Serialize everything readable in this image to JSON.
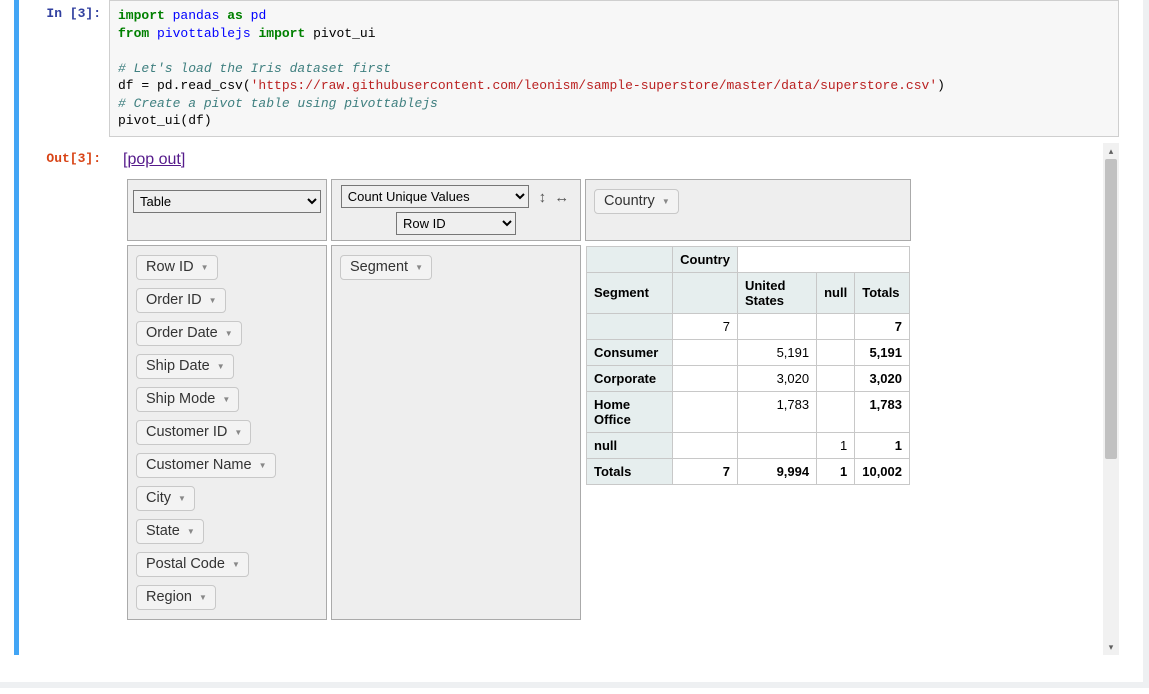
{
  "prompt": {
    "in": "In [3]:",
    "out": "Out[3]:"
  },
  "code": {
    "l1_kw1": "import",
    "l1_mod": "pandas",
    "l1_kw2": "as",
    "l1_alias": "pd",
    "l2_kw1": "from",
    "l2_mod": "pivottablejs",
    "l2_kw2": "import",
    "l2_name": "pivot_ui",
    "l4_comment": "# Let's load the Iris dataset first",
    "l5_a": "df = pd.read_csv(",
    "l5_str": "'https://raw.githubusercontent.com/leonism/sample-superstore/master/data/superstore.csv'",
    "l5_b": ")",
    "l6_comment": "# Create a pivot table using pivottablejs",
    "l7": "pivot_ui(df)"
  },
  "popout": "[pop out]",
  "renderer": "Table",
  "aggregator": "Count Unique Values",
  "aggregator_attr": "Row ID",
  "sort_row_icon": "↕",
  "sort_col_icon": "↔",
  "col_field": "Country",
  "row_field": "Segment",
  "unused_fields": [
    "Row ID",
    "Order ID",
    "Order Date",
    "Ship Date",
    "Ship Mode",
    "Customer ID",
    "Customer Name",
    "City",
    "State",
    "Postal Code",
    "Region"
  ],
  "table": {
    "col_axis": "Country",
    "row_axis": "Segment",
    "col_headers": [
      "United States",
      "null",
      "Totals"
    ],
    "rows": [
      {
        "label": "",
        "empty": "7",
        "cells": [
          "",
          "",
          "7"
        ]
      },
      {
        "label": "Consumer",
        "empty": "",
        "cells": [
          "5,191",
          "",
          "5,191"
        ]
      },
      {
        "label": "Corporate",
        "empty": "",
        "cells": [
          "3,020",
          "",
          "3,020"
        ]
      },
      {
        "label": "Home Office",
        "empty": "",
        "cells": [
          "1,783",
          "",
          "1,783"
        ]
      },
      {
        "label": "null",
        "empty": "",
        "cells": [
          "",
          "1",
          "1"
        ]
      }
    ],
    "totals_label": "Totals",
    "totals_empty": "7",
    "totals": [
      "9,994",
      "1",
      "10,002"
    ]
  }
}
